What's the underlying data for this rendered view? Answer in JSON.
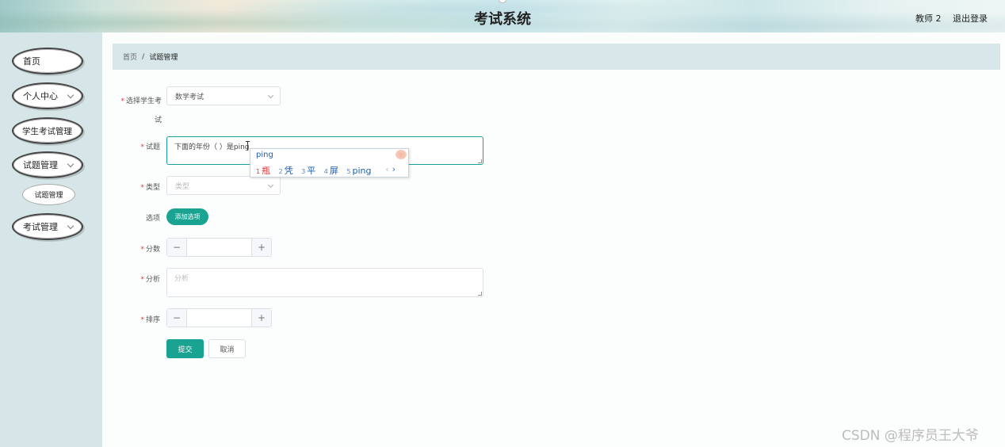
{
  "header": {
    "title": "考试系统",
    "user": "教师 2",
    "logout": "退出登录"
  },
  "sidebar": {
    "items": [
      {
        "label": "首页"
      },
      {
        "label": "个人中心"
      },
      {
        "label": "学生考试管理"
      },
      {
        "label": "试题管理"
      },
      {
        "label": "考试管理"
      }
    ],
    "sub_item": "试题管理"
  },
  "breadcrumb": {
    "home": "首页",
    "separator": "/",
    "current": "试题管理"
  },
  "form": {
    "exam_label": "选择学生考试",
    "exam_value": "数学考试",
    "question_label": "试题",
    "question_value": "下面的年份（    ）是ping",
    "type_label": "类型",
    "type_placeholder": "类型",
    "options_label": "选项",
    "add_option_button": "添加选项",
    "score_label": "分数",
    "analysis_label": "分析",
    "analysis_placeholder": "分析",
    "order_label": "排序",
    "stepper_minus": "−",
    "stepper_plus": "+",
    "submit_button": "提交",
    "cancel_button": "取消"
  },
  "ime": {
    "input": "ping",
    "candidates": [
      {
        "num": "1",
        "text": "瓶"
      },
      {
        "num": "2",
        "text": "凭"
      },
      {
        "num": "3",
        "text": "平"
      },
      {
        "num": "4",
        "text": "屏"
      },
      {
        "num": "5",
        "text": "ping"
      }
    ],
    "prev": "‹",
    "next": "›"
  },
  "watermark": "CSDN @程序员王大爷",
  "colors": {
    "accent": "#1aa391",
    "sidebar_bg": "#d6e6e8",
    "breadcrumb_bg": "#d8e8ea",
    "required": "#e4393c"
  }
}
